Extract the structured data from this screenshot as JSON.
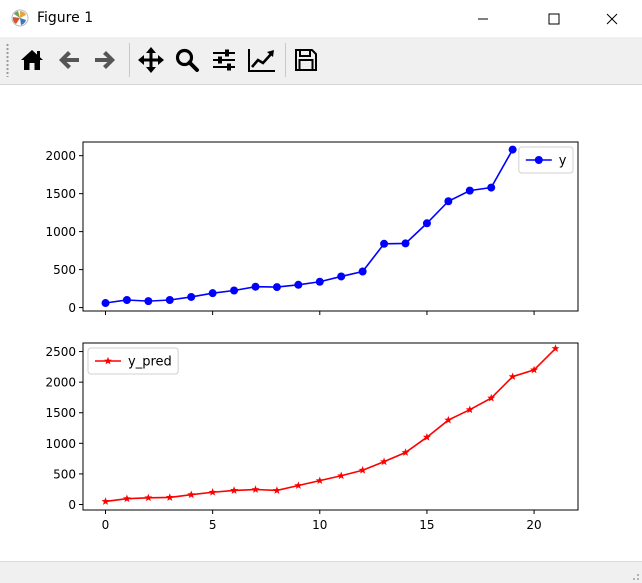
{
  "window": {
    "title": "Figure 1"
  },
  "toolbar": {
    "buttons": [
      {
        "name": "home-button",
        "icon": "home-icon"
      },
      {
        "name": "back-button",
        "icon": "arrow-left-icon"
      },
      {
        "name": "forward-button",
        "icon": "arrow-right-icon"
      },
      {
        "name": "pan-button",
        "icon": "move-icon"
      },
      {
        "name": "zoom-button",
        "icon": "magnifier-icon"
      },
      {
        "name": "configure-subplots-button",
        "icon": "sliders-icon"
      },
      {
        "name": "edit-axes-button",
        "icon": "line-chart-icon"
      },
      {
        "name": "save-button",
        "icon": "floppy-disk-icon"
      }
    ]
  },
  "chart_data": [
    {
      "type": "line",
      "title": "",
      "xlabel": "",
      "ylabel": "",
      "xlim": [
        -1.05,
        22.05
      ],
      "ylim": [
        -45,
        2180
      ],
      "yticks": [
        0,
        500,
        1000,
        1500,
        2000
      ],
      "xticks": [
        0,
        5,
        10,
        15,
        20
      ],
      "show_xtick_labels": false,
      "grid": false,
      "legend": "upper right",
      "series": [
        {
          "name": "y",
          "color": "#0000ff",
          "marker": "circle",
          "x": [
            0,
            1,
            2,
            3,
            4,
            5,
            6,
            7,
            8,
            9,
            10,
            11,
            12,
            13,
            14,
            15,
            16,
            17,
            18,
            19
          ],
          "values": [
            60,
            100,
            85,
            100,
            140,
            190,
            225,
            275,
            270,
            300,
            340,
            410,
            475,
            840,
            845,
            1110,
            1400,
            1540,
            1580,
            2080
          ]
        }
      ]
    },
    {
      "type": "line",
      "title": "",
      "xlabel": "",
      "ylabel": "",
      "xlim": [
        -1.05,
        22.05
      ],
      "ylim": [
        -90,
        2640
      ],
      "yticks": [
        0,
        500,
        1000,
        1500,
        2000,
        2500
      ],
      "xticks": [
        0,
        5,
        10,
        15,
        20
      ],
      "show_xtick_labels": true,
      "grid": false,
      "legend": "upper left",
      "series": [
        {
          "name": "y_pred",
          "color": "#ff0000",
          "marker": "star",
          "x": [
            0,
            1,
            2,
            3,
            4,
            5,
            6,
            7,
            8,
            9,
            10,
            11,
            12,
            13,
            14,
            15,
            16,
            17,
            18,
            19,
            20,
            21
          ],
          "values": [
            50,
            95,
            110,
            115,
            160,
            200,
            230,
            245,
            230,
            310,
            390,
            470,
            560,
            700,
            850,
            1100,
            1380,
            1550,
            1740,
            2090,
            2200,
            2550
          ]
        }
      ]
    }
  ]
}
